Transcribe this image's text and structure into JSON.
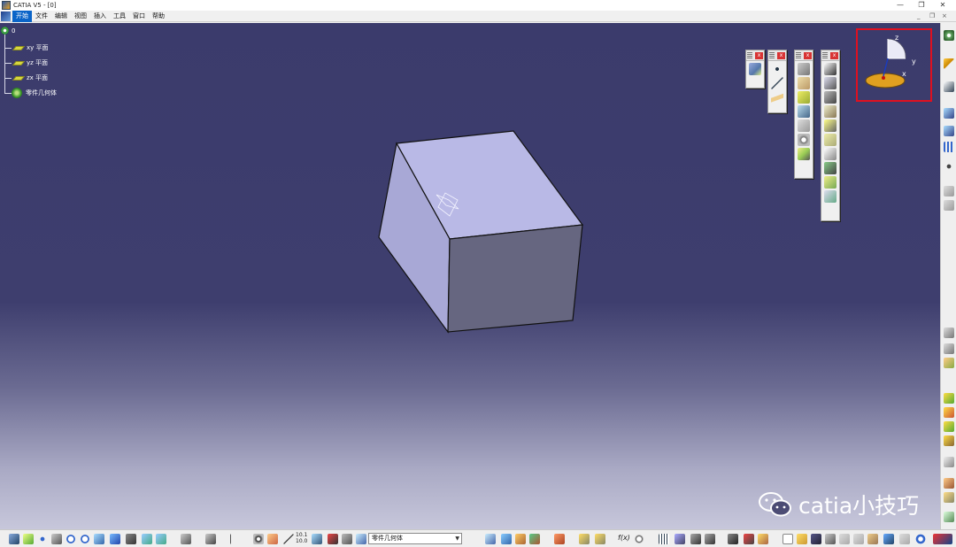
{
  "window": {
    "title": "CATIA V5 - [0]",
    "minimize": "—",
    "restore": "❐",
    "close": "✕"
  },
  "menubar": {
    "items": [
      "开始",
      "文件",
      "编辑",
      "视图",
      "插入",
      "工具",
      "窗口",
      "帮助"
    ],
    "active_index": 0,
    "doc_controls": [
      "_",
      "❐",
      "×"
    ]
  },
  "tree": {
    "root": "0",
    "nodes": [
      {
        "label": "xy 平面",
        "icon": "plane-icon"
      },
      {
        "label": "yz 平面",
        "icon": "plane-icon"
      },
      {
        "label": "zx 平面",
        "icon": "plane-icon"
      },
      {
        "label": "零件几何体",
        "icon": "part-body-icon"
      }
    ]
  },
  "compass": {
    "axis_x": "x",
    "axis_y": "y",
    "axis_z": "z"
  },
  "bottom_toolbar": {
    "current_body": "零件几何体",
    "readout_top": "10.1",
    "readout_bottom": "10.0",
    "formula_label": "f(x)"
  },
  "watermark": {
    "text": "catia小技巧"
  },
  "colors": {
    "viewport_top": "#3b3b6c",
    "viewport_bottom": "#c7c7db",
    "cube_top": "#b9b9e6",
    "cube_left": "#a8a8d6",
    "cube_front": "#666680",
    "highlight": "#e01020",
    "menu_active": "#0a64c8"
  }
}
